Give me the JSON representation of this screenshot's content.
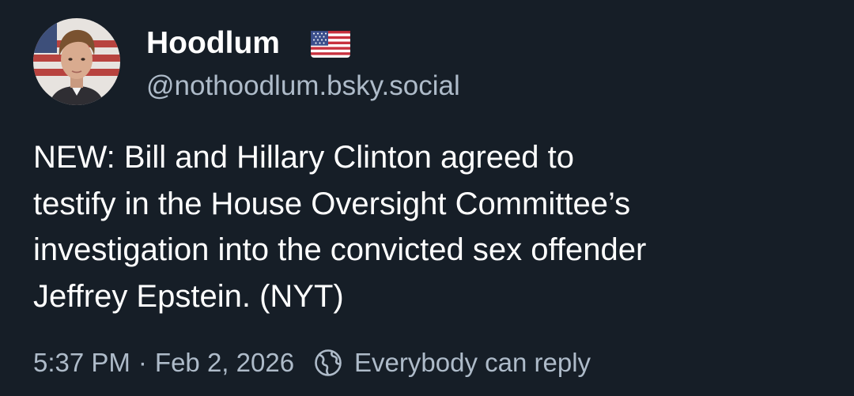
{
  "author": {
    "display_name": "Hoodlum",
    "handle": "@nothoodlum.bsky.social",
    "avatar_icon": "profile-photo-avatar",
    "name_emoji_icon": "us-flag-icon"
  },
  "post": {
    "text": "NEW: Bill and Hillary Clinton agreed to\ntestify in the House Oversight Committee’s\ninvestigation into the convicted sex offender\nJeffrey Epstein. (NYT)"
  },
  "meta": {
    "time": "5:37 PM",
    "separator": "·",
    "date": "Feb 2, 2026",
    "reply_setting_icon": "globe-icon",
    "reply_setting": "Everybody can reply"
  },
  "colors": {
    "background": "#161e27",
    "text_primary": "#ffffff",
    "text_secondary": "#aebbc9"
  }
}
